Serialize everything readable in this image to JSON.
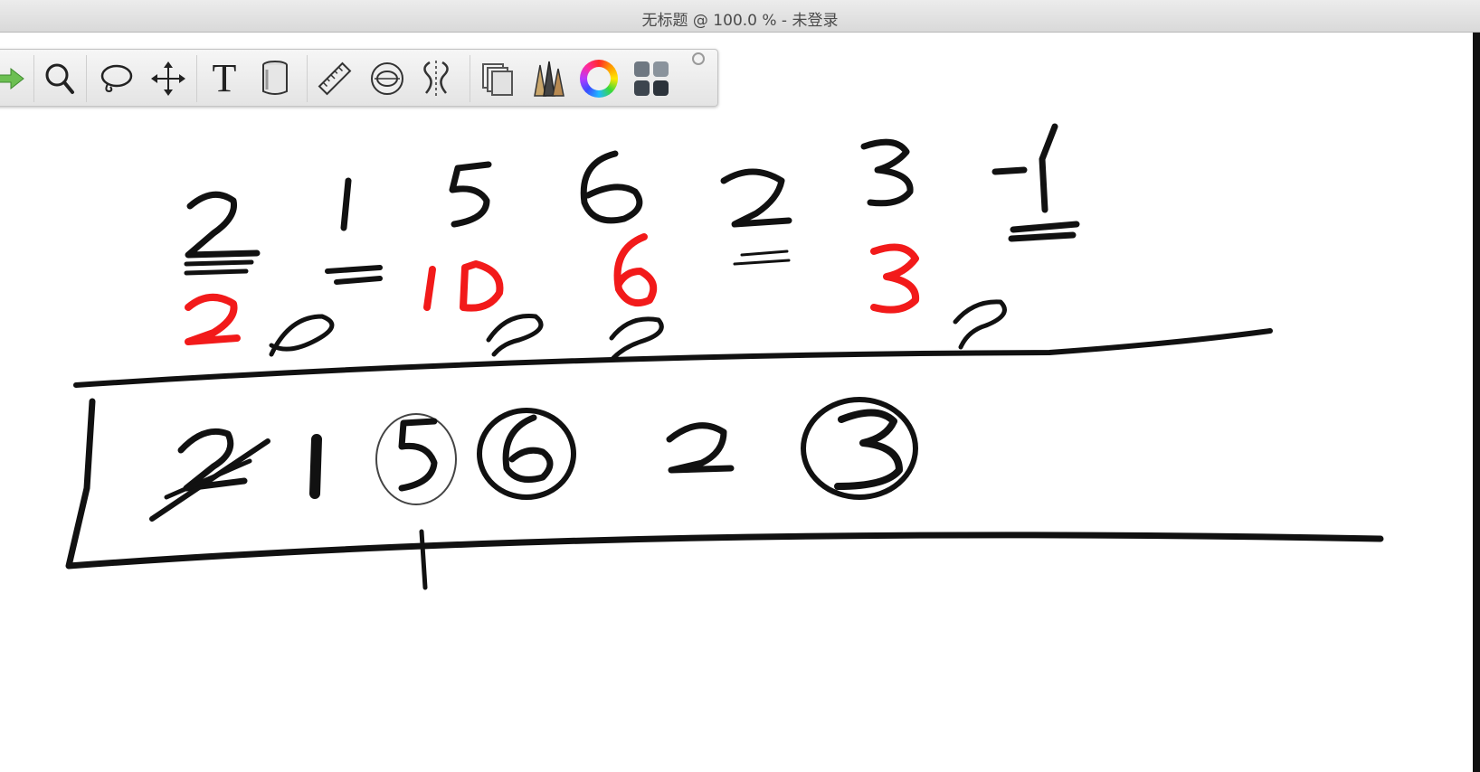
{
  "window": {
    "title": "无标题 @ 100.0 % - 未登录"
  },
  "toolbar": {
    "tools": [
      {
        "name": "arrow-icon"
      },
      {
        "name": "magnifier-icon"
      },
      {
        "name": "lasso-icon"
      },
      {
        "name": "move-icon"
      },
      {
        "name": "text-tool-icon",
        "glyph": "T"
      },
      {
        "name": "fill-bucket-icon"
      },
      {
        "name": "ruler-icon"
      },
      {
        "name": "ellipse-guide-icon"
      },
      {
        "name": "symmetry-icon"
      },
      {
        "name": "layers-icon"
      },
      {
        "name": "brush-library-icon"
      },
      {
        "name": "color-wheel-icon"
      },
      {
        "name": "tool-grid-icon"
      }
    ]
  },
  "colors": {
    "ink": "#111111",
    "red_ink": "#f21a1a",
    "toolbar_bg": "#eeeeee",
    "arrow_green": "#5fb34a"
  }
}
